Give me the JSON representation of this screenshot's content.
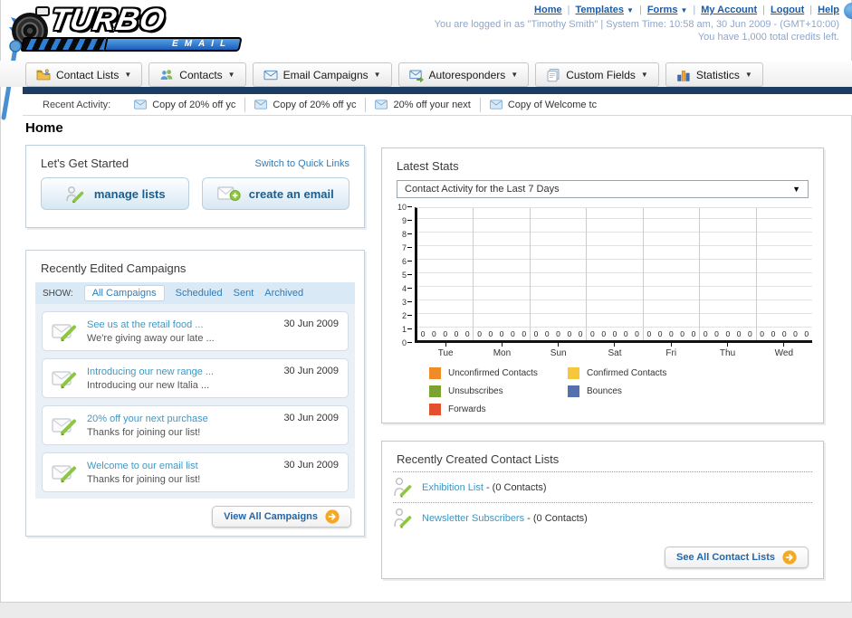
{
  "page": {
    "logo_top": "TURBO",
    "logo_bottom": "EMAIL"
  },
  "header": {
    "links": [
      {
        "label": "Home",
        "caret": false
      },
      {
        "label": "Templates",
        "caret": true
      },
      {
        "label": "Forms",
        "caret": true
      },
      {
        "label": "My Account",
        "caret": false
      },
      {
        "label": "Logout",
        "caret": false
      },
      {
        "label": "Help",
        "caret": false
      }
    ],
    "login_info": "You are logged in as \"Timothy Smith\" | System Time: 10:58 am, 30 Jun 2009 - (GMT+10:00)",
    "credits_info": "You have 1,000 total credits left."
  },
  "nav": {
    "tabs": [
      {
        "label": "Contact Lists",
        "icon": "folder-icon"
      },
      {
        "label": "Contacts",
        "icon": "contacts-icon"
      },
      {
        "label": "Email Campaigns",
        "icon": "envelope-icon"
      },
      {
        "label": "Autoresponders",
        "icon": "autoresponder-icon"
      },
      {
        "label": "Custom Fields",
        "icon": "custom-fields-icon"
      },
      {
        "label": "Statistics",
        "icon": "statistics-icon"
      }
    ]
  },
  "recent_activity": {
    "label": "Recent Activity:",
    "items": [
      "Copy of 20% off yc",
      "Copy of 20% off yc",
      "20% off your next ",
      "Copy of Welcome tc"
    ]
  },
  "home": {
    "title": "Home"
  },
  "get_started": {
    "title": "Let's Get Started",
    "switch_link": "Switch to Quick Links",
    "buttons": [
      {
        "label": "manage lists",
        "icon": "manage-lists-icon"
      },
      {
        "label": "create an email",
        "icon": "create-email-icon"
      }
    ]
  },
  "campaigns": {
    "title": "Recently Edited Campaigns",
    "show_label": "SHOW:",
    "filters": [
      {
        "label": "All Campaigns",
        "active": true
      },
      {
        "label": "Scheduled",
        "active": false
      },
      {
        "label": "Sent",
        "active": false
      },
      {
        "label": "Archived",
        "active": false
      }
    ],
    "items": [
      {
        "title": "See us at the retail food ...",
        "subtitle": "We're giving away our late ...",
        "date": "30 Jun 2009"
      },
      {
        "title": "Introducing our new range ...",
        "subtitle": "Introducing our new Italia ...",
        "date": "30 Jun 2009"
      },
      {
        "title": "20% off your next purchase",
        "subtitle": "Thanks for joining our list!",
        "date": "30 Jun 2009"
      },
      {
        "title": "Welcome to our email list",
        "subtitle": "Thanks for joining our list!",
        "date": "30 Jun 2009"
      }
    ],
    "view_all_label": "View All Campaigns"
  },
  "stats": {
    "title": "Latest Stats",
    "selected_option": "Contact Activity for the Last 7 Days"
  },
  "chart_data": {
    "type": "bar",
    "title": "Contact Activity for the Last 7 Days",
    "categories": [
      "Tue",
      "Mon",
      "Sun",
      "Sat",
      "Fri",
      "Thu",
      "Wed"
    ],
    "series": [
      {
        "name": "Unconfirmed Contacts",
        "color": "#F08C28",
        "values": [
          0,
          0,
          0,
          0,
          0,
          0,
          0
        ]
      },
      {
        "name": "Confirmed Contacts",
        "color": "#F6C73B",
        "values": [
          0,
          0,
          0,
          0,
          0,
          0,
          0
        ]
      },
      {
        "name": "Unsubscribes",
        "color": "#7BA233",
        "values": [
          0,
          0,
          0,
          0,
          0,
          0,
          0
        ]
      },
      {
        "name": "Bounces",
        "color": "#5471AD",
        "values": [
          0,
          0,
          0,
          0,
          0,
          0,
          0
        ]
      },
      {
        "name": "Forwards",
        "color": "#E2502F",
        "values": [
          0,
          0,
          0,
          0,
          0,
          0,
          0
        ]
      }
    ],
    "ylim": [
      0,
      10
    ],
    "yticks": [
      0,
      1,
      2,
      3,
      4,
      5,
      6,
      7,
      8,
      9,
      10
    ],
    "grid": true,
    "legend_position": "bottom"
  },
  "contact_lists": {
    "title": "Recently Created Contact Lists",
    "items": [
      {
        "name": "Exhibition List",
        "detail": "- (0 Contacts)"
      },
      {
        "name": "Newsletter Subscribers",
        "detail": "- (0 Contacts)"
      }
    ],
    "see_all_label": "See All Contact Lists"
  }
}
